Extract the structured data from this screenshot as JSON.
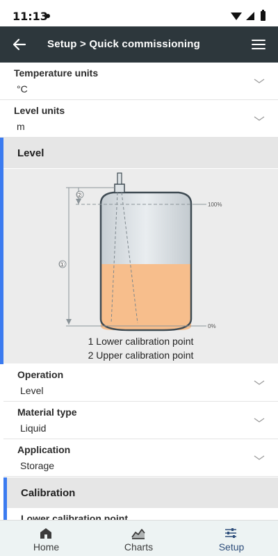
{
  "status": {
    "time": "11:13"
  },
  "appbar": {
    "title": "Setup > Quick commissioning"
  },
  "fields_top": [
    {
      "label": "Temperature units",
      "value": "°C"
    },
    {
      "label": "Level units",
      "value": "m"
    }
  ],
  "level_section": {
    "title": "Level",
    "diagram": {
      "marker_1": "①",
      "marker_2": "②",
      "pct_100": "100%",
      "pct_0": "0%"
    },
    "legend": [
      "1 Lower calibration point",
      "2 Upper calibration point"
    ],
    "fields": [
      {
        "label": "Operation",
        "value": "Level"
      },
      {
        "label": "Material type",
        "value": "Liquid"
      },
      {
        "label": "Application",
        "value": "Storage"
      }
    ]
  },
  "calibration_section": {
    "title": "Calibration",
    "next_label": "Lower calibration point"
  },
  "bottom_nav": [
    {
      "label": "Home",
      "icon": "home-icon"
    },
    {
      "label": "Charts",
      "icon": "chart-icon"
    },
    {
      "label": "Setup",
      "icon": "setup-sliders-icon",
      "active": true
    }
  ],
  "colors": {
    "appbar": "#2d373c",
    "accent": "#3b7bf0",
    "liquid": "#f7be8c",
    "nav_active": "#2d4d7a"
  }
}
